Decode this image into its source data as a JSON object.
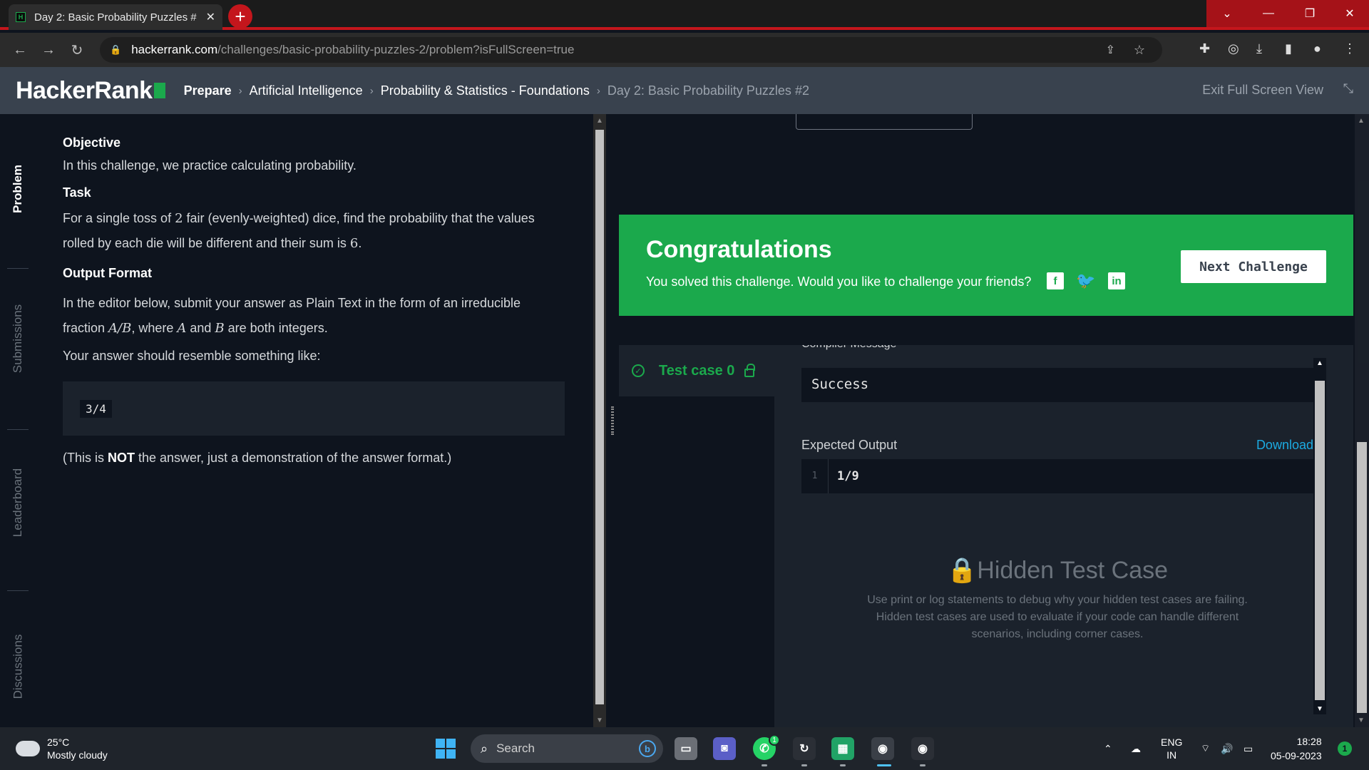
{
  "browser": {
    "tab_title": "Day 2: Basic Probability Puzzles #",
    "tab_close": "✕",
    "new_tab": "+",
    "url_host": "hackerrank.com",
    "url_path": "/challenges/basic-probability-puzzles-2/problem?isFullScreen=true",
    "accent": "#c4161c"
  },
  "header": {
    "logo_text": "HackerRank",
    "breadcrumbs": [
      "Prepare",
      "Artificial Intelligence",
      "Probability & Statistics - Foundations",
      "Day 2: Basic Probability Puzzles #2"
    ],
    "exit_fullscreen": "Exit Full Screen View"
  },
  "sidebar": {
    "tabs": [
      "Problem",
      "Submissions",
      "Leaderboard",
      "Discussions"
    ],
    "active": "Problem"
  },
  "problem": {
    "objective_heading": "Objective",
    "objective_text": "In this challenge, we practice calculating probability.",
    "task_heading": "Task",
    "task_text_1": "For a single toss of ",
    "task_num_dice": "2",
    "task_text_2": " fair (evenly-weighted) dice, find the probability that the values rolled by each die will be different and their sum is ",
    "task_sum": "6",
    "task_text_3": ".",
    "output_heading": "Output Format",
    "output_text_1": "In the editor below, submit your answer as Plain Text in the form of an irreducible fraction ",
    "output_frac": "A/B",
    "output_text_2": ", where ",
    "output_a": "A",
    "output_text_3": " and ",
    "output_b": "B",
    "output_text_4": " are both integers.",
    "resemble_text": "Your answer should resemble something like:",
    "sample_code": "3/4",
    "note_pre": "(This is ",
    "note_bold": "NOT",
    "note_post": " the answer, just a demonstration of the answer format.)"
  },
  "congrats": {
    "title": "Congratulations",
    "message": "You solved this challenge. Would you like to challenge your friends?",
    "facebook": "f",
    "twitter": "🐦",
    "linkedin": "in",
    "next_button": "Next Challenge",
    "color": "#1ba94c"
  },
  "results": {
    "test_case_label": "Test case 0",
    "compiler_message_label": "Compiler Message",
    "compiler_message": "Success",
    "expected_output_label": "Expected Output",
    "download_label": "Download",
    "expected_line_no": "1",
    "expected_value": "1/9",
    "hidden_title": "Hidden Test Case",
    "hidden_text": "Use print or log statements to debug why your hidden test cases are failing. Hidden test cases are used to evaluate if your code can handle different scenarios, including corner cases."
  },
  "taskbar": {
    "temperature": "25°C",
    "weather": "Mostly cloudy",
    "search_placeholder": "Search",
    "whatsapp_badge": "1",
    "lang_1": "ENG",
    "lang_2": "IN",
    "time": "18:28",
    "date": "05-09-2023",
    "notification_count": "1"
  }
}
